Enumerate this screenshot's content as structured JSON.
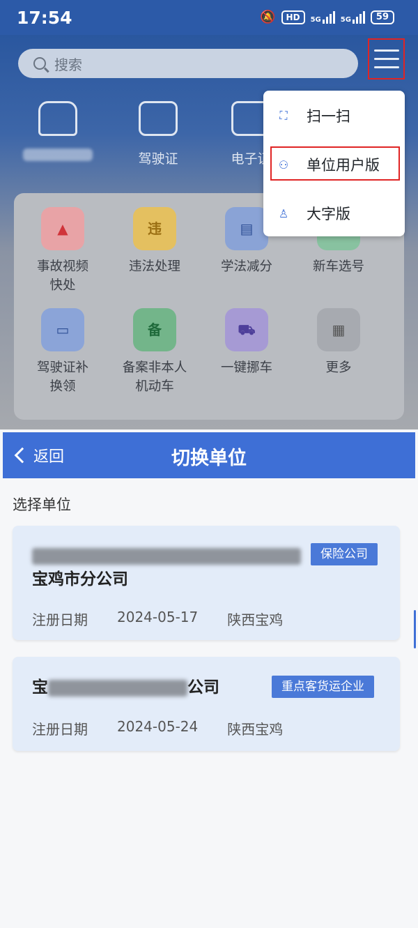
{
  "status_bar": {
    "time": "17:54",
    "hd_label": "HD",
    "net1": "5G",
    "net2": "5G",
    "battery": "59"
  },
  "home": {
    "search_placeholder": "搜索",
    "quick_icons": [
      {
        "label": "",
        "icon": "car-icon"
      },
      {
        "label": "驾驶证",
        "icon": "license-icon"
      },
      {
        "label": "电子证",
        "icon": "e-cert-icon"
      }
    ],
    "grid": [
      {
        "label": "事故视频快处",
        "icon": "siren-icon",
        "color": "#e8a3a6"
      },
      {
        "label": "违法处理",
        "icon": "violation-icon",
        "color": "#e4c060",
        "glyph": "违"
      },
      {
        "label": "学法减分",
        "icon": "book-icon",
        "color": "#8aa3d6"
      },
      {
        "label": "新车选号",
        "icon": "new-car-icon",
        "color": "#88c2a0"
      },
      {
        "label": "驾驶证补换领",
        "icon": "card-replace-icon",
        "color": "#8ba4d8"
      },
      {
        "label": "备案非本人机动车",
        "icon": "shield-icon",
        "color": "#73b58a",
        "glyph": "备"
      },
      {
        "label": "一键挪车",
        "icon": "tow-truck-icon",
        "color": "#a69ad4"
      },
      {
        "label": "更多",
        "icon": "more-icon",
        "color": "#a7aab0"
      }
    ],
    "menu": [
      {
        "label": "扫一扫",
        "icon": "scan-icon"
      },
      {
        "label": "单位用户版",
        "icon": "unit-user-icon"
      },
      {
        "label": "大字版",
        "icon": "large-text-icon"
      }
    ]
  },
  "switch_unit": {
    "back_label": "返回",
    "title": "切换单位",
    "section_label": "选择单位",
    "units": [
      {
        "name_line1_tail": "",
        "name_line2": "宝鸡市分公司",
        "tag": "保险公司",
        "date_label": "注册日期",
        "date": "2024-05-17",
        "region": "陕西宝鸡"
      },
      {
        "name_prefix": "宝",
        "name_suffix": "公司",
        "tag": "重点客货运企业",
        "date_label": "注册日期",
        "date": "2024-05-24",
        "region": "陕西宝鸡"
      }
    ]
  },
  "colors": {
    "primary": "#3e6fd6",
    "highlight_border": "#e02424",
    "card_bg": "#e3ecf9"
  }
}
